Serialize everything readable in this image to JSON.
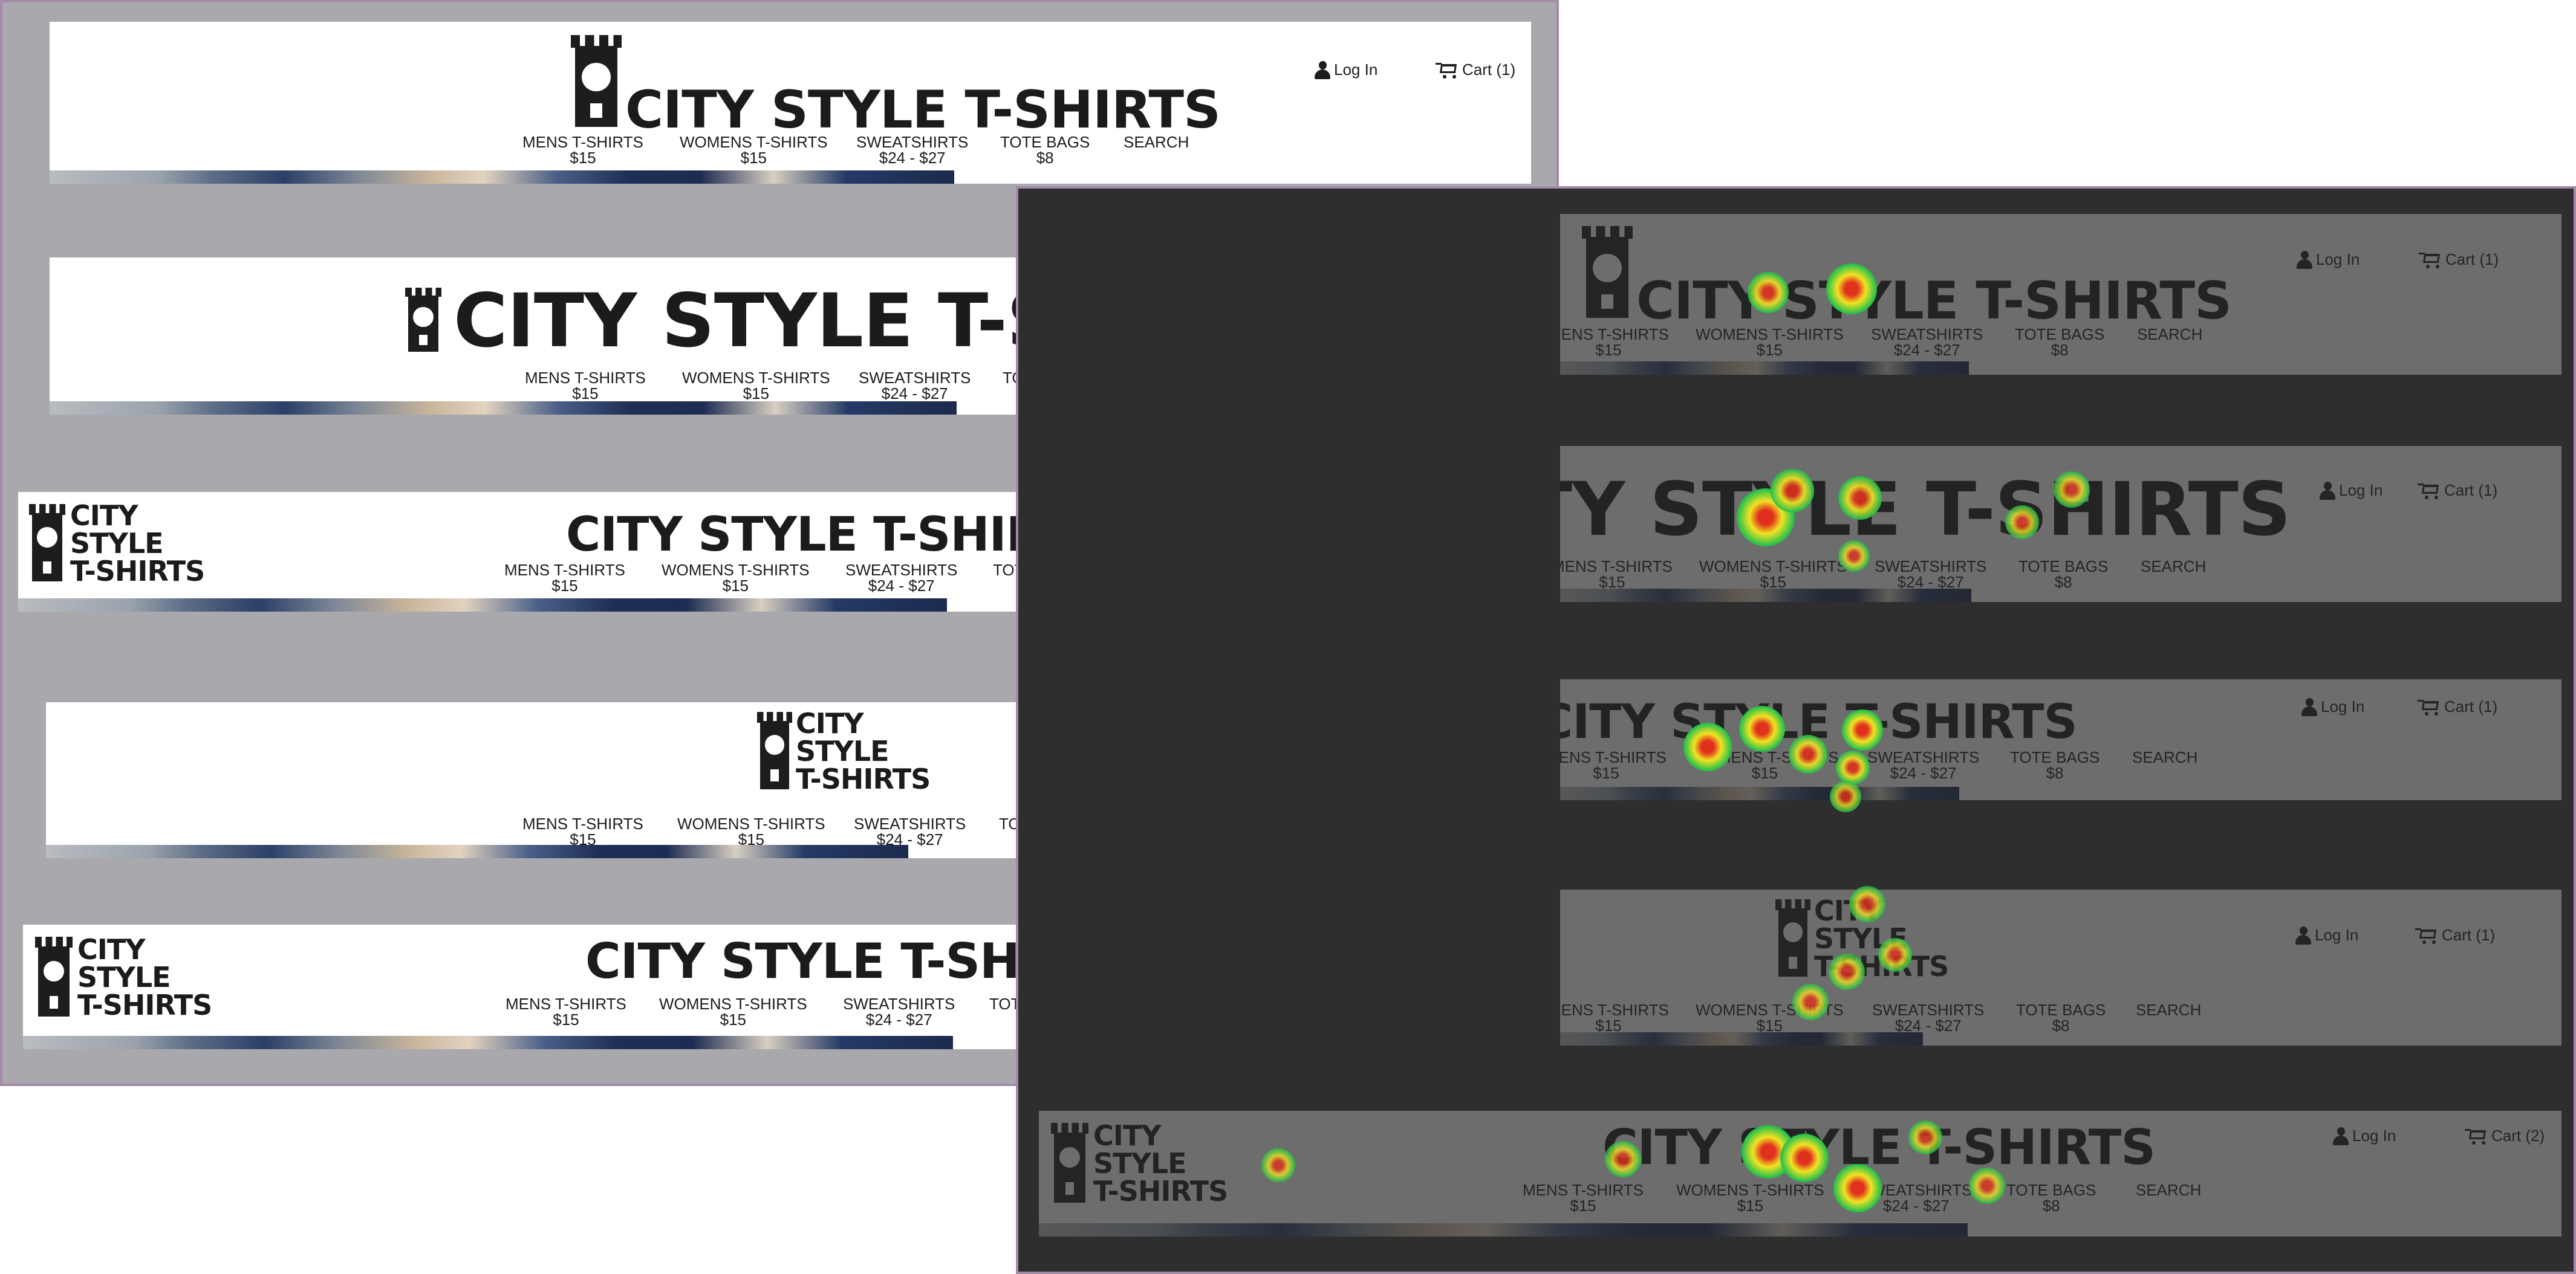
{
  "panels": {
    "left": {
      "label": "original-variants"
    },
    "right": {
      "label": "heatmap-overlay"
    }
  },
  "colors": {
    "border": "#a48aa9",
    "left_bg": "#a9a9ad",
    "right_bg": "#3b3b3b",
    "heat_core": "#e0301e",
    "heat_mid": "#f2e322",
    "heat_edge": "#29c24a"
  },
  "brand": "CITY STYLE T-SHIRTS",
  "brand_stacked": "CITY\nSTYLE\nT-SHIRTS",
  "nav": [
    {
      "label": "MENS T-SHIRTS",
      "price": "$15"
    },
    {
      "label": "WOMENS T-SHIRTS",
      "price": "$15"
    },
    {
      "label": "SWEATSHIRTS",
      "price": "$24 - $27"
    },
    {
      "label": "TOTE BAGS",
      "price": "$8"
    },
    {
      "label": "SEARCH",
      "price": ""
    }
  ],
  "account": {
    "login": "Log In",
    "cart_1": "Cart (1)",
    "cart_2": "Cart (2)",
    "user_icon": "user-icon",
    "cart_icon": "cart-icon"
  }
}
